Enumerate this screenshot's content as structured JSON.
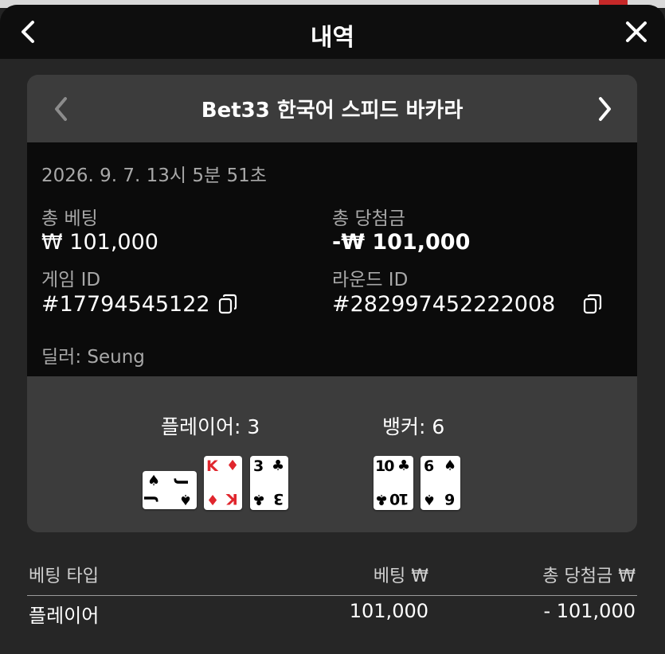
{
  "header": {
    "title": "내역",
    "back_icon": "chevron-left-icon",
    "close_icon": "close-icon"
  },
  "card": {
    "title": "Bet33 한국어 스피드 바카라",
    "datetime": "2026. 9. 7. 13시 5분 51초",
    "total_bet_label": "총 베팅",
    "total_bet_value": "₩ 101,000",
    "total_win_label": "총 당첨금",
    "total_win_value": "-₩ 101,000",
    "game_id_label": "게임 ID",
    "game_id_value": "#17794545122",
    "round_id_label": "라운드 ID",
    "round_id_value": "#282997452222008",
    "dealer": "딜러: Seung"
  },
  "result": {
    "player_label": "플레이어: 3",
    "banker_label": "뱅커: 6",
    "player_cards": [
      {
        "rank": "J",
        "suit": "♠",
        "color": "#000000",
        "orientation": "sideways"
      },
      {
        "rank": "K",
        "suit": "♦",
        "color": "#e0262d"
      },
      {
        "rank": "3",
        "suit": "♣",
        "color": "#000000"
      }
    ],
    "banker_cards": [
      {
        "rank": "10",
        "suit": "♣",
        "color": "#000000"
      },
      {
        "rank": "6",
        "suit": "♠",
        "color": "#000000"
      }
    ]
  },
  "bets_table": {
    "columns": [
      "베팅 타입",
      "베팅 ₩",
      "총 당첨금 ₩"
    ],
    "rows": [
      {
        "type": "플레이어",
        "bet": "101,000",
        "win": "- 101,000"
      }
    ]
  }
}
